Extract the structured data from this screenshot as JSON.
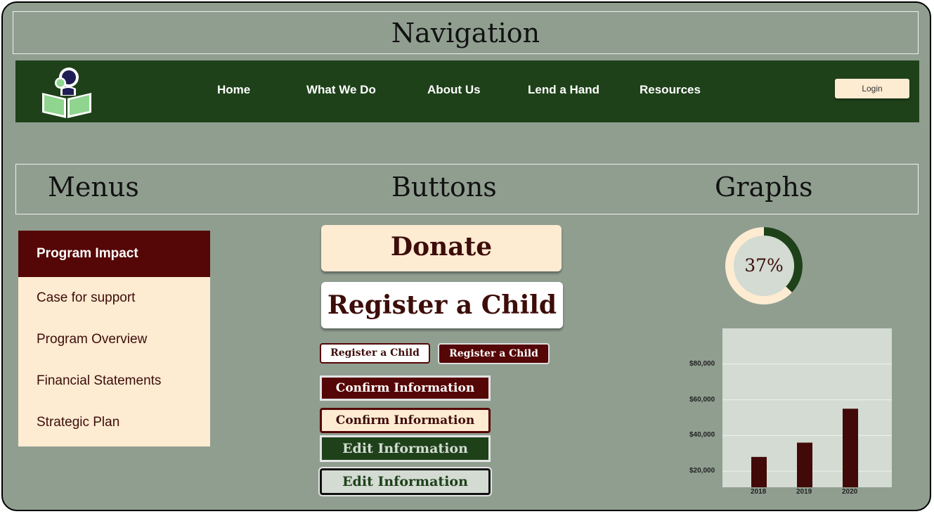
{
  "sections": {
    "navigation": "Navigation",
    "menus": "Menus",
    "buttons": "Buttons",
    "graphs": "Graphs"
  },
  "nav": {
    "logo_icon": "reading-child-book-icon",
    "links": [
      "Home",
      "What We Do",
      "About Us",
      "Lend a Hand",
      "Resources"
    ],
    "login_label": "Login"
  },
  "menu": {
    "items": [
      {
        "label": "Program Impact",
        "active": true
      },
      {
        "label": "Case for support",
        "active": false
      },
      {
        "label": "Program Overview",
        "active": false
      },
      {
        "label": "Financial Statements",
        "active": false
      },
      {
        "label": "Strategic Plan",
        "active": false
      }
    ]
  },
  "buttons": {
    "donate": "Donate",
    "register_large": "Register a Child",
    "register_small_outline": "Register a Child",
    "register_small_filled": "Register a Child",
    "confirm_filled": "Confirm Information",
    "confirm_outline": "Confirm Information",
    "edit_filled": "Edit Information",
    "edit_outline": "Edit Information"
  },
  "donut": {
    "label": "37%",
    "value": 0.37
  },
  "chart_data": {
    "type": "bar",
    "categories": [
      "2018",
      "2019",
      "2020"
    ],
    "values": [
      28000,
      36000,
      55000
    ],
    "y_ticks": [
      "$20,000",
      "$40,000",
      "$60,000",
      "$80,000"
    ],
    "y_tick_values": [
      20000,
      40000,
      60000,
      80000
    ],
    "ylim": [
      11000,
      100000
    ],
    "grid": true,
    "xlabel": "",
    "ylabel": "",
    "title": ""
  },
  "colors": {
    "background": "#909e90",
    "nav_green": "#1e4119",
    "maroon": "#550606",
    "cream": "#fdebd2",
    "bar": "#420909"
  }
}
